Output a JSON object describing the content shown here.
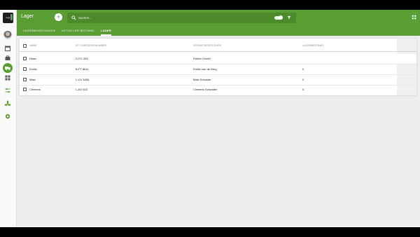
{
  "app": {
    "logo_text": "logo",
    "title": "Lager",
    "add_button": "+",
    "search_placeholder": "Suchen..."
  },
  "tabs": [
    {
      "label": "LAGERBEWEGUNGEN"
    },
    {
      "label": "AKTUELLER BESTAND"
    },
    {
      "label": "LAGER"
    }
  ],
  "sidebar": {
    "items": [
      {
        "icon": "calendar-icon"
      },
      {
        "icon": "briefcase-icon"
      },
      {
        "icon": "truck-icon",
        "active": true
      },
      {
        "icon": "dashboard-icon"
      },
      {
        "icon": "tune-icon"
      },
      {
        "icon": "fan-icon"
      },
      {
        "icon": "gear-icon"
      }
    ]
  },
  "table": {
    "headers": [
      "NAME",
      "ID / FAHRZEUGNUMMER",
      "VERANTWORTLICHER",
      "LAGERBESTAND"
    ],
    "rows": [
      [
        "Kilian",
        "D-FG 335",
        "Rößler GmbH",
        ""
      ],
      [
        "Emilio",
        "B-FT 8611",
        "Emilio van de Berg",
        "0"
      ],
      [
        "Mats",
        "L-UV 3458",
        "Mats Schuster",
        "0"
      ],
      [
        "Clemens",
        "L-AO 623",
        "Clemens Schwalbe",
        "0"
      ]
    ]
  },
  "colors": {
    "primary": "#5a9e33",
    "primary_dark": "#4d8a2b",
    "background": "#eeeeee"
  }
}
